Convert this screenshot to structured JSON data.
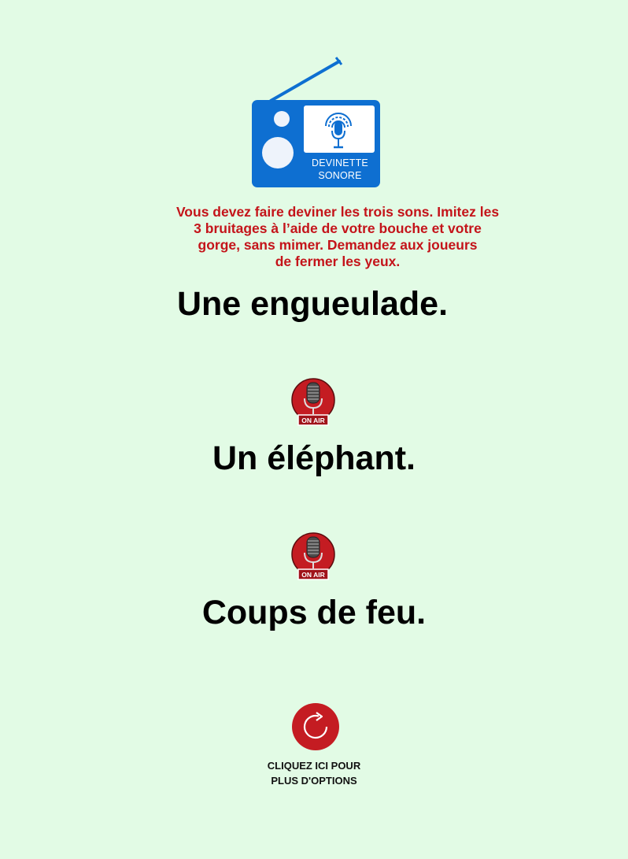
{
  "logo": {
    "line1": "DEVINETTE",
    "line2": "SONORE",
    "icon": "radio-microphone-icon"
  },
  "instructions": {
    "lines": [
      "Vous devez faire deviner les trois sons. Imitez les",
      "3 bruitages à l’aide de votre bouche et votre",
      "gorge, sans mimer. Demandez aux joueurs",
      "de fermer les yeux."
    ]
  },
  "sounds": [
    "Une engueulade.",
    "Un éléphant.",
    "Coups de feu."
  ],
  "separator": {
    "label": "ON AIR",
    "icon": "on-air-microphone-icon"
  },
  "options": {
    "icon": "refresh-icon",
    "line1": "CLIQUEZ ICI POUR",
    "line2": "PLUS D'OPTIONS"
  },
  "colors": {
    "background": "#e2fbe5",
    "radio_blue": "#0e6fd1",
    "instruction_red": "#c4141a",
    "button_red": "#c41c22"
  }
}
